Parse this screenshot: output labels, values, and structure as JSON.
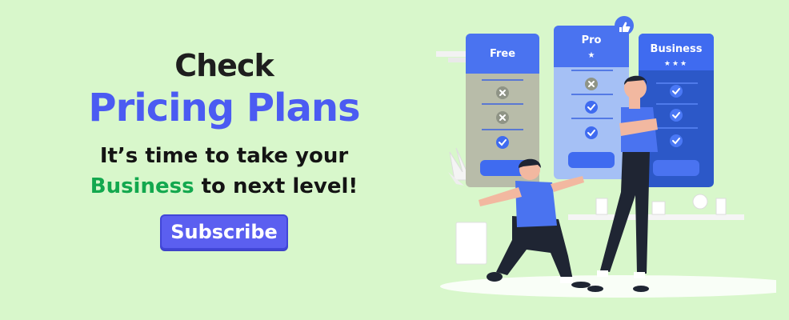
{
  "hero": {
    "line1": "Check",
    "line2": "Pricing Plans",
    "tagline_line1": "It’s time to take your",
    "tagline_highlight": "Business",
    "tagline_rest": " to next level!",
    "cta_label": "Subscribe"
  },
  "plans": [
    {
      "name": "Free",
      "stars": "",
      "features": [
        "no",
        "no",
        "yes"
      ]
    },
    {
      "name": "Pro",
      "stars": "★",
      "features": [
        "no",
        "yes",
        "yes"
      ]
    },
    {
      "name": "Business",
      "stars": "★★★",
      "features": [
        "yes",
        "yes",
        "yes"
      ]
    }
  ],
  "icons": {
    "check": "check-icon",
    "cross": "cross-icon",
    "like": "thumbs-up-icon"
  },
  "colors": {
    "background": "#d8f7cb",
    "accent": "#4b5bf2",
    "highlight": "#13a84e",
    "free_card": "#b8bca9",
    "pro_card": "#a5c0f5",
    "business_card": "#2c58c8"
  }
}
